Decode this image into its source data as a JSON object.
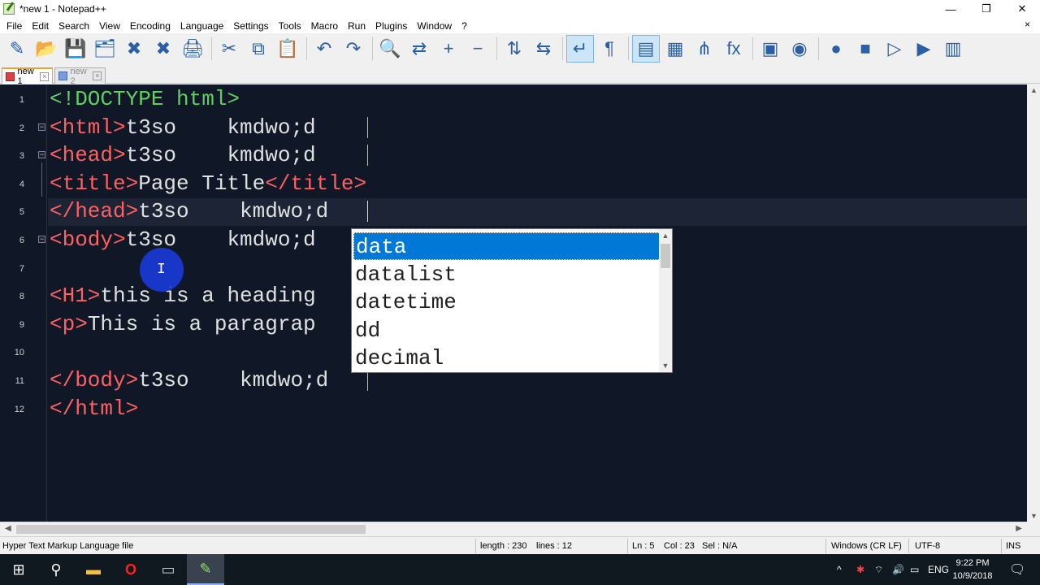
{
  "window": {
    "title": "*new 1 - Notepad++",
    "controls": [
      "—",
      "❐",
      "✕"
    ]
  },
  "menu": [
    "File",
    "Edit",
    "Search",
    "View",
    "Encoding",
    "Language",
    "Settings",
    "Tools",
    "Macro",
    "Run",
    "Plugins",
    "Window",
    "?"
  ],
  "menu_close": "×",
  "toolbar": {
    "icons": [
      "new-file-icon",
      "open-file-icon",
      "save-icon",
      "save-all-icon",
      "close-icon",
      "close-all-icon",
      "print-icon",
      "cut-icon",
      "copy-icon",
      "paste-icon",
      "undo-icon",
      "redo-icon",
      "find-icon",
      "replace-icon",
      "zoom-in-icon",
      "zoom-out-icon",
      "sync-vertical-icon",
      "sync-horizontal-icon",
      "word-wrap-icon",
      "show-all-chars-icon",
      "indent-guide-icon",
      "doc-map-icon",
      "function-list-icon",
      "fx-icon",
      "folder-as-workspace-icon",
      "monitoring-icon",
      "record-macro-icon",
      "stop-macro-icon",
      "play-macro-icon",
      "run-macro-icon",
      "save-macro-icon"
    ],
    "glyphs": [
      "✎",
      "📂",
      "💾",
      "🗂",
      "✖",
      "✖",
      "🖨",
      "✂",
      "⧉",
      "📋",
      "↶",
      "↷",
      "🔍",
      "⇄",
      "+",
      "−",
      "⇅",
      "⇆",
      "↵",
      "¶",
      "▤",
      "▦",
      "⋔",
      "fx",
      "▣",
      "◉",
      "●",
      "■",
      "▷",
      "▶",
      "▥"
    ]
  },
  "tabs": [
    {
      "label": "new 1",
      "active": true
    },
    {
      "label": "new 2",
      "active": false
    }
  ],
  "editor": {
    "lines": [
      {
        "num": "1",
        "parts": [
          {
            "t": "<!DOCTYPE html>",
            "c": "doct"
          }
        ]
      },
      {
        "num": "2",
        "parts": [
          {
            "t": "<html>",
            "c": "tag"
          },
          {
            "t": "t3so    kmdwo;d",
            "c": ""
          }
        ]
      },
      {
        "num": "3",
        "parts": [
          {
            "t": "<head>",
            "c": "tag"
          },
          {
            "t": "t3so    kmdwo;d",
            "c": ""
          }
        ]
      },
      {
        "num": "4",
        "parts": [
          {
            "t": "<title>",
            "c": "tag"
          },
          {
            "t": "Page Title",
            "c": ""
          },
          {
            "t": "</title>",
            "c": "tag"
          }
        ]
      },
      {
        "num": "5",
        "parts": [
          {
            "t": "</head>",
            "c": "tag"
          },
          {
            "t": "t3so    kmdwo;d",
            "c": ""
          }
        ]
      },
      {
        "num": "6",
        "parts": [
          {
            "t": "<body>",
            "c": "tag"
          },
          {
            "t": "t3so    kmdwo;d",
            "c": ""
          }
        ]
      },
      {
        "num": "7",
        "parts": []
      },
      {
        "num": "8",
        "parts": [
          {
            "t": "<H1>",
            "c": "tag"
          },
          {
            "t": "this is a heading",
            "c": ""
          }
        ]
      },
      {
        "num": "9",
        "parts": [
          {
            "t": "<p>",
            "c": "tag"
          },
          {
            "t": "This is a paragrap",
            "c": ""
          }
        ]
      },
      {
        "num": "10",
        "parts": []
      },
      {
        "num": "11",
        "parts": [
          {
            "t": "</body>",
            "c": "tag"
          },
          {
            "t": "t3so    kmdwo;d",
            "c": ""
          }
        ]
      },
      {
        "num": "12",
        "parts": [
          {
            "t": "</html>",
            "c": "tag"
          }
        ]
      }
    ],
    "fold_markers": [
      "2",
      "3",
      "6"
    ]
  },
  "autocomplete": {
    "items": [
      "data",
      "datalist",
      "datetime",
      "dd",
      "decimal"
    ],
    "selected_index": 0
  },
  "status": {
    "file_type": "Hyper Text Markup Language file",
    "length": "length : 230",
    "lines": "lines : 12",
    "ln": "Ln : 5",
    "col": "Col : 23",
    "sel": "Sel : N/A",
    "eol": "Windows (CR LF)",
    "encoding": "UTF-8",
    "mode": "INS"
  },
  "taskbar": {
    "icons": [
      "windows-start-icon",
      "search-icon",
      "file-explorer-icon",
      "opera-icon",
      "app-icon",
      "notepadpp-icon"
    ],
    "glyphs": [
      "⊞",
      "⚲",
      "▬",
      "O",
      "▭",
      "✎"
    ],
    "tray_icons": [
      "chevron-up-icon",
      "network-app-icon",
      "wifi-icon",
      "volume-icon",
      "battery-icon"
    ],
    "tray_glyphs": [
      "^",
      "✱",
      "⌔",
      "🔊",
      "▭"
    ],
    "language": "ENG",
    "time": "9:22 PM",
    "date": "10/9/2018",
    "notification_glyph": "🗨"
  }
}
